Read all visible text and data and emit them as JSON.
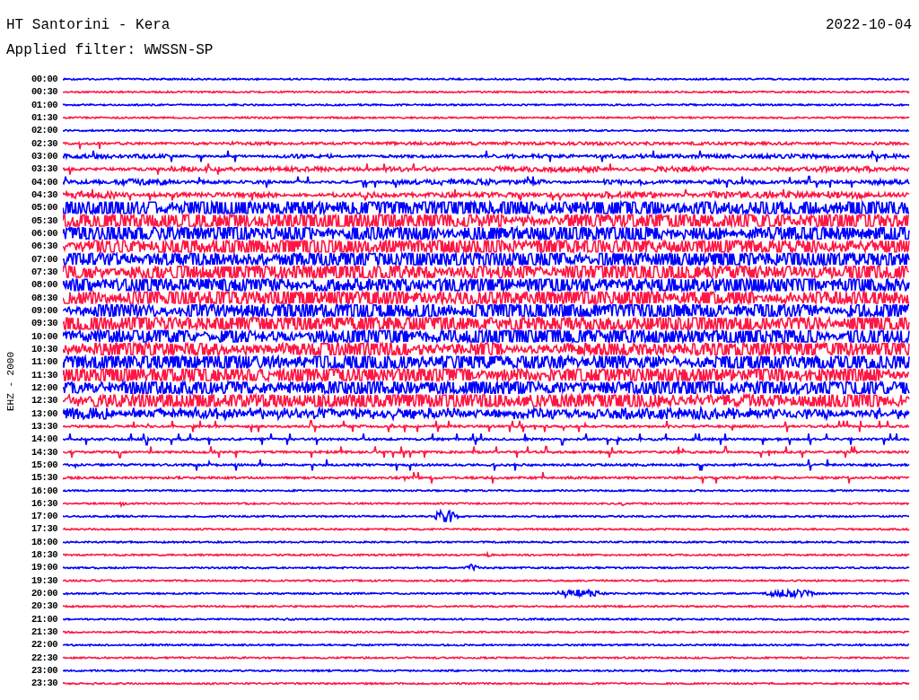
{
  "header": {
    "station": "HT Santorini - Kera",
    "date": "2022-10-04",
    "filter": "Applied filter: WWSSN-SP"
  },
  "axis_label": "EHZ - 2000",
  "rows": [
    {
      "time": "00:00",
      "color": "#0000ff"
    },
    {
      "time": "00:30",
      "color": "#ff1744"
    },
    {
      "time": "01:00",
      "color": "#0000ff"
    },
    {
      "time": "01:30",
      "color": "#ff1744"
    },
    {
      "time": "02:00",
      "color": "#0000ff"
    },
    {
      "time": "02:30",
      "color": "#ff1744"
    },
    {
      "time": "03:00",
      "color": "#0000ff"
    },
    {
      "time": "03:30",
      "color": "#ff1744"
    },
    {
      "time": "04:00",
      "color": "#0000ff"
    },
    {
      "time": "04:30",
      "color": "#ff1744"
    },
    {
      "time": "05:00",
      "color": "#0000ff"
    },
    {
      "time": "05:30",
      "color": "#ff1744"
    },
    {
      "time": "06:00",
      "color": "#0000ff"
    },
    {
      "time": "06:30",
      "color": "#ff1744"
    },
    {
      "time": "07:00",
      "color": "#0000ff"
    },
    {
      "time": "07:30",
      "color": "#ff1744"
    },
    {
      "time": "08:00",
      "color": "#0000ff"
    },
    {
      "time": "08:30",
      "color": "#ff1744"
    },
    {
      "time": "09:00",
      "color": "#0000ff"
    },
    {
      "time": "09:30",
      "color": "#ff1744"
    },
    {
      "time": "10:00",
      "color": "#0000ff"
    },
    {
      "time": "10:30",
      "color": "#ff1744"
    },
    {
      "time": "11:00",
      "color": "#0000ff"
    },
    {
      "time": "11:30",
      "color": "#ff1744"
    },
    {
      "time": "12:00",
      "color": "#0000ff"
    },
    {
      "time": "12:30",
      "color": "#ff1744"
    },
    {
      "time": "13:00",
      "color": "#0000ff"
    },
    {
      "time": "13:30",
      "color": "#ff1744"
    },
    {
      "time": "14:00",
      "color": "#0000ff"
    },
    {
      "time": "14:30",
      "color": "#ff1744"
    },
    {
      "time": "15:00",
      "color": "#0000ff"
    },
    {
      "time": "15:30",
      "color": "#ff1744"
    },
    {
      "time": "16:00",
      "color": "#0000ff"
    },
    {
      "time": "16:30",
      "color": "#ff1744"
    },
    {
      "time": "17:00",
      "color": "#0000ff"
    },
    {
      "time": "17:30",
      "color": "#ff1744"
    },
    {
      "time": "18:00",
      "color": "#0000ff"
    },
    {
      "time": "18:30",
      "color": "#ff1744"
    },
    {
      "time": "19:00",
      "color": "#0000ff"
    },
    {
      "time": "19:30",
      "color": "#ff1744"
    },
    {
      "time": "20:00",
      "color": "#0000ff"
    },
    {
      "time": "20:30",
      "color": "#ff1744"
    },
    {
      "time": "21:00",
      "color": "#0000ff"
    },
    {
      "time": "21:30",
      "color": "#ff1744"
    },
    {
      "time": "22:00",
      "color": "#0000ff"
    },
    {
      "time": "22:30",
      "color": "#ff1744"
    },
    {
      "time": "23:00",
      "color": "#0000ff"
    },
    {
      "time": "23:30",
      "color": "#ff1744"
    }
  ]
}
